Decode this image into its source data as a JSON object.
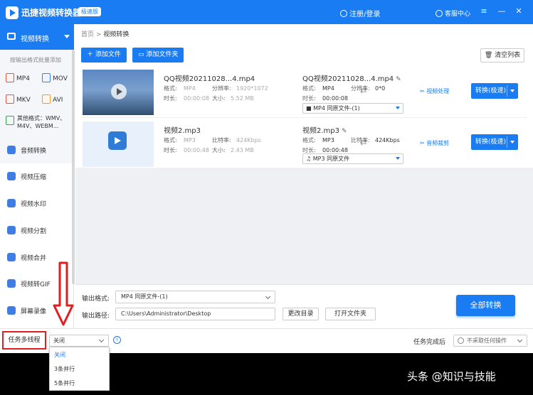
{
  "app": {
    "title": "迅捷视频转换器",
    "badge": "极速版",
    "login": "注册/登录",
    "service": "客服中心"
  },
  "sidebar": {
    "active": "视频转换",
    "batch_hint": "按输出格式批量添加",
    "formats": [
      "MP4",
      "MOV",
      "MKV",
      "AVI"
    ],
    "other_formats": [
      "其他格式：WMV、",
      "M4V、WEBM..."
    ],
    "items": [
      "音频转换",
      "视频压缩",
      "视频水印",
      "视频分割",
      "视频合并",
      "视频转GIF",
      "屏幕录像"
    ]
  },
  "breadcrumb": {
    "home": "首页",
    "sep": ">",
    "current": "视频转换"
  },
  "toolbar": {
    "add_file": "添加文件",
    "add_folder": "添加文件夹",
    "clear": "清空列表"
  },
  "files": [
    {
      "name": "QQ视频20211028...4.mp4",
      "src_labels": [
        "格式:",
        "分辨率:",
        "时长:",
        "大小:"
      ],
      "src_values": [
        "MP4",
        "1920*1072",
        "00:00:08",
        "5.52 MB"
      ],
      "out_name": "QQ视频20211028...4.mp4",
      "out_labels": [
        "格式:",
        "分辨率:",
        "时长:"
      ],
      "out_values": [
        "MP4",
        "0*0",
        "00:00:08"
      ],
      "out_select": "MP4  同原文件-(1)",
      "tool": "视频处理",
      "convert": "转换(极速)"
    },
    {
      "name": "视频2.mp3",
      "src_labels": [
        "格式:",
        "比特率:",
        "时长:",
        "大小:"
      ],
      "src_values": [
        "MP3",
        "424Kbps",
        "00:00:48",
        "2.43 MB"
      ],
      "out_name": "视频2.mp3",
      "out_labels": [
        "格式:",
        "比特率:",
        "时长:"
      ],
      "out_values": [
        "MP3",
        "424Kbps",
        "00:00:48"
      ],
      "out_select": "MP3  同原文件",
      "tool": "音频裁剪",
      "convert": "转换(极速)"
    }
  ],
  "output": {
    "format_label": "输出格式:",
    "format_value": "MP4  同原文件-(1)",
    "path_label": "输出路径:",
    "path_value": "C:\\Users\\Administrator\\Desktop",
    "change_dir": "更改目录",
    "open_folder": "打开文件夹",
    "convert_all": "全部转换"
  },
  "status": {
    "multi_thread": "任务多线程",
    "thread_value": "关闭",
    "thread_options": [
      "关闭",
      "3条并行",
      "5条并行"
    ],
    "on_complete_label": "任务完成后",
    "on_complete_value": "不采取任何操作"
  },
  "watermark": "头条 @知识与技能",
  "colors": {
    "accent": "#1a7cf3",
    "highlight": "#e21e1e"
  }
}
